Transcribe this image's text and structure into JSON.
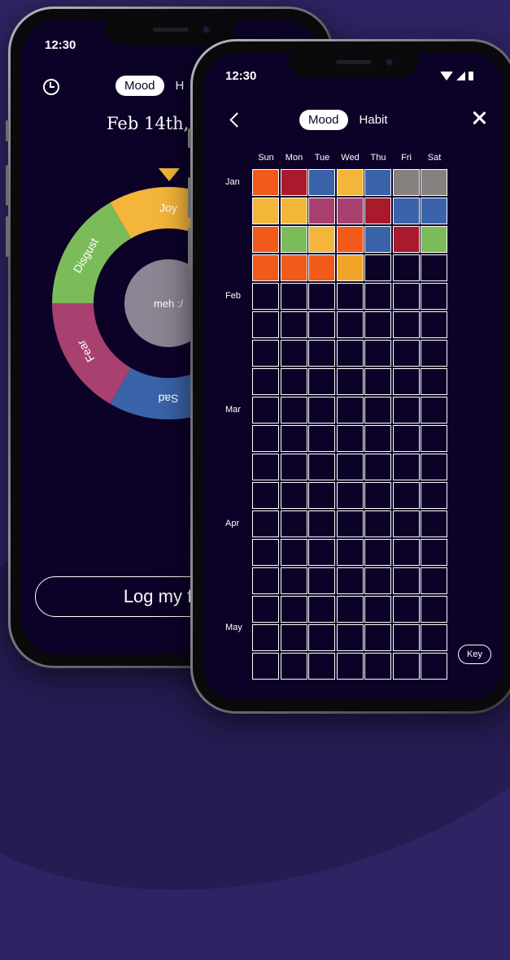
{
  "status_time": "12:30",
  "back_screen": {
    "tabs": {
      "active": "Mood",
      "other": "H"
    },
    "date_title": "Feb 14th, 2",
    "wheel": {
      "segments": [
        {
          "label": "Joy",
          "color": "#f4b63a"
        },
        {
          "label": "Disgust",
          "color": "#7cbb5a"
        },
        {
          "label": "Fear",
          "color": "#a8416f"
        },
        {
          "label": "Sad",
          "color": "#3a63aa"
        }
      ],
      "center_label": "meh :/",
      "center_color": "#8c8593"
    },
    "log_button": "Log my f"
  },
  "front_screen": {
    "tabs": {
      "active": "Mood",
      "other": "Habit"
    },
    "weekdays": [
      "Sun",
      "Mon",
      "Tue",
      "Wed",
      "Thu",
      "Fri",
      "Sat"
    ],
    "months": [
      "Jan",
      "Feb",
      "Mar",
      "Apr",
      "May"
    ],
    "key_button": "Key",
    "rows_visible": 18,
    "colors": {
      "O": "#f15a1a",
      "R": "#a81a2c",
      "B": "#3a63aa",
      "Y": "#f4b63a",
      "G": "#85817f",
      "P": "#a8416f",
      "L": "#7cbb5a",
      "A": "#f1a52a"
    },
    "filled_rows": [
      [
        "O",
        "R",
        "B",
        "Y",
        "B",
        "G",
        "G"
      ],
      [
        "Y",
        "Y",
        "P",
        "P",
        "R",
        "B",
        "B"
      ],
      [
        "O",
        "L",
        "Y",
        "O",
        "B",
        "R",
        "L"
      ],
      [
        "O",
        "O",
        "O",
        "A",
        "",
        "",
        ""
      ]
    ]
  }
}
